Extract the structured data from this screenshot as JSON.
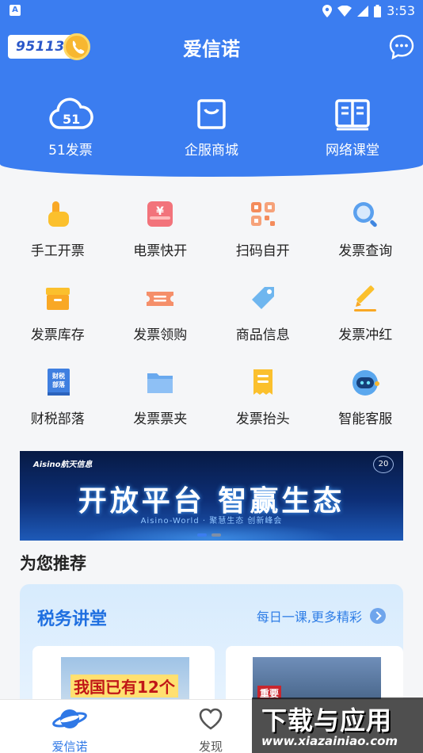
{
  "status_bar": {
    "time": "3:53",
    "app_indicator": "A"
  },
  "header": {
    "hotline_number": "95113",
    "title": "爱信诺",
    "top_entries": [
      {
        "label": "51发票",
        "icon": "cloud-51-icon"
      },
      {
        "label": "企服商城",
        "icon": "shopping-bag-icon"
      },
      {
        "label": "网络课堂",
        "icon": "book-icon"
      }
    ]
  },
  "services": [
    {
      "label": "手工开票",
      "icon": "hand-pointer-icon"
    },
    {
      "label": "电票快开",
      "icon": "yen-invoice-icon"
    },
    {
      "label": "扫码自开",
      "icon": "qr-code-icon"
    },
    {
      "label": "发票查询",
      "icon": "search-icon"
    },
    {
      "label": "发票库存",
      "icon": "archive-box-icon"
    },
    {
      "label": "发票领购",
      "icon": "ticket-icon"
    },
    {
      "label": "商品信息",
      "icon": "tag-icon"
    },
    {
      "label": "发票冲红",
      "icon": "pencil-icon"
    },
    {
      "label": "财税部落",
      "icon": "tax-book-icon",
      "icon_text": "财税部落"
    },
    {
      "label": "发票票夹",
      "icon": "folder-icon"
    },
    {
      "label": "发票抬头",
      "icon": "receipt-icon"
    },
    {
      "label": "智能客服",
      "icon": "robot-icon"
    }
  ],
  "banner": {
    "brand": "Aisino航天信息",
    "badge": "20",
    "title": "开放平台 智赢生态",
    "subtitle": "Aisino-World · 聚慧生态 创新峰会",
    "active_index": 0
  },
  "recommend": {
    "title": "为您推荐",
    "lecture": {
      "title": "税务讲堂",
      "more": "每日一课,更多精彩",
      "cards": [
        {
          "thumb_text": "我国已有12个"
        },
        {
          "thumb_text": "重要"
        }
      ]
    }
  },
  "bottom_nav": [
    {
      "label": "爱信诺",
      "icon": "planet-icon",
      "active": true
    },
    {
      "label": "发现",
      "icon": "heart-icon",
      "active": false
    }
  ],
  "watermark": {
    "title": "下载与应用",
    "url": "www.xiazainiao.com"
  },
  "colors": {
    "brand_blue": "#3b7df0",
    "lecture_title": "#1f6fe0"
  }
}
